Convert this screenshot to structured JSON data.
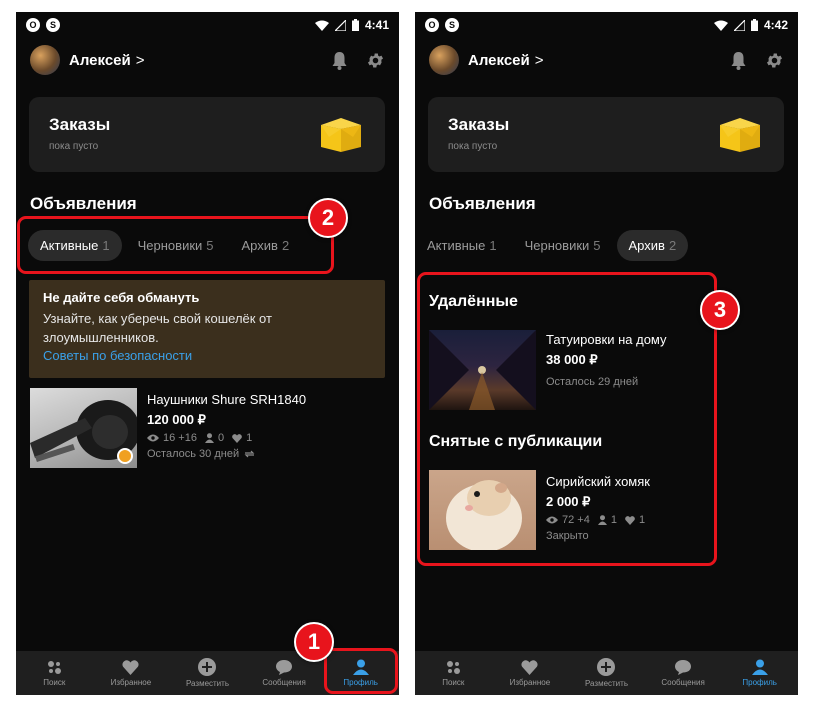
{
  "left": {
    "status": {
      "time": "4:41"
    },
    "profile": {
      "name": "Алексей",
      "chevron": ">"
    },
    "orders": {
      "title": "Заказы",
      "subtitle": "пока пусто"
    },
    "section_title": "Объявления",
    "tabs": [
      {
        "label": "Активные",
        "count": "1",
        "active": true
      },
      {
        "label": "Черновики",
        "count": "5",
        "active": false
      },
      {
        "label": "Архив",
        "count": "2",
        "active": false
      }
    ],
    "warning": {
      "title": "Не дайте себя обмануть",
      "text": "Узнайте, как уберечь свой кошелёк от злоумышленников.",
      "link": "Советы по безопасности"
    },
    "ad": {
      "title": "Наушники Shure SRH1840",
      "price": "120 000 ₽",
      "views": "16 +16",
      "contacts": "0",
      "favorites": "1",
      "remaining": "Осталось 30 дней"
    },
    "badges": {
      "b1": "1",
      "b2": "2"
    }
  },
  "right": {
    "status": {
      "time": "4:42"
    },
    "profile": {
      "name": "Алексей",
      "chevron": ">"
    },
    "orders": {
      "title": "Заказы",
      "subtitle": "пока пусто"
    },
    "section_title": "Объявления",
    "tabs": [
      {
        "label": "Активные",
        "count": "1",
        "active": false
      },
      {
        "label": "Черновики",
        "count": "5",
        "active": false
      },
      {
        "label": "Архив",
        "count": "2",
        "active": true
      }
    ],
    "deleted": {
      "heading": "Удалённые",
      "title": "Татуировки на дому",
      "price": "38 000 ₽",
      "remaining": "Осталось 29 дней"
    },
    "unpublished": {
      "heading": "Снятые с публикации",
      "title": "Сирийский хомяк",
      "price": "2 000 ₽",
      "views": "72 +4",
      "contacts": "1",
      "favorites": "1",
      "status": "Закрыто"
    },
    "badges": {
      "b3": "3"
    }
  },
  "nav": {
    "search": "Поиск",
    "favorites": "Избранное",
    "post": "Разместить",
    "messages": "Сообщения",
    "profile": "Профиль"
  },
  "colors": {
    "background": "#0a0a0a",
    "card": "#1e1e1e",
    "warning_card": "#3b2f1d",
    "accent_blue": "#3aa0e8",
    "highlight_red": "#e8141c",
    "box_icon_yellow": "#f5c518"
  },
  "icons": [
    "bell-icon",
    "gear-icon",
    "box-icon",
    "eye-icon",
    "person-icon",
    "heart-icon",
    "refresh-icon",
    "search-icon",
    "plus-icon",
    "chat-icon",
    "profile-icon"
  ]
}
